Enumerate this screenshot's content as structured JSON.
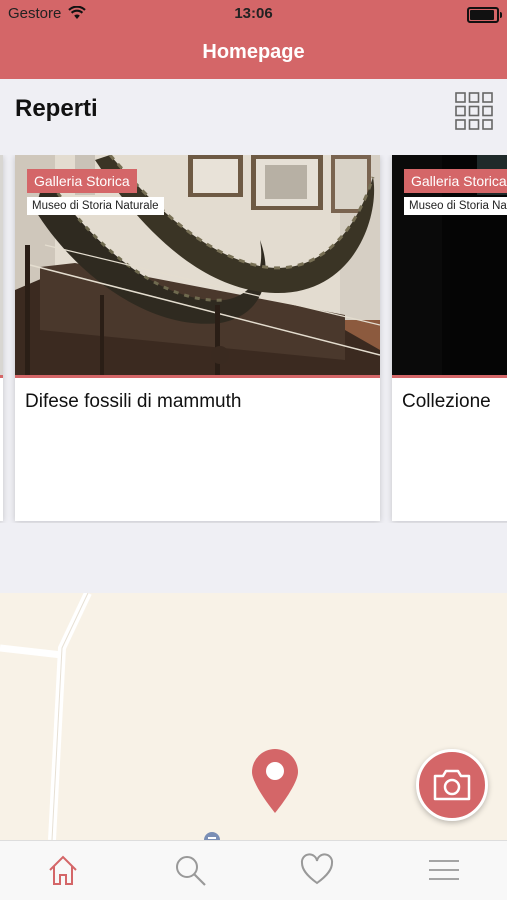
{
  "status_bar": {
    "carrier": "Gestore",
    "time": "13:06",
    "battery_level": 0.85
  },
  "nav": {
    "title": "Homepage"
  },
  "section": {
    "title": "Reperti"
  },
  "cards": [
    {
      "gallery": "Galleria Storica",
      "museum": "Museo di Storia Naturale",
      "title": "Difese fossili di mammuth"
    },
    {
      "gallery": "Galleria Storica",
      "museum": "Museo di Storia Naturale",
      "title": "Collezione"
    }
  ],
  "tabs": [
    {
      "icon": "home-icon",
      "active": true
    },
    {
      "icon": "search-icon",
      "active": false
    },
    {
      "icon": "heart-icon",
      "active": false
    },
    {
      "icon": "menu-icon",
      "active": false
    }
  ],
  "colors": {
    "accent": "#d46668",
    "map_bg": "#f8f2e7",
    "background": "#efeff4"
  }
}
